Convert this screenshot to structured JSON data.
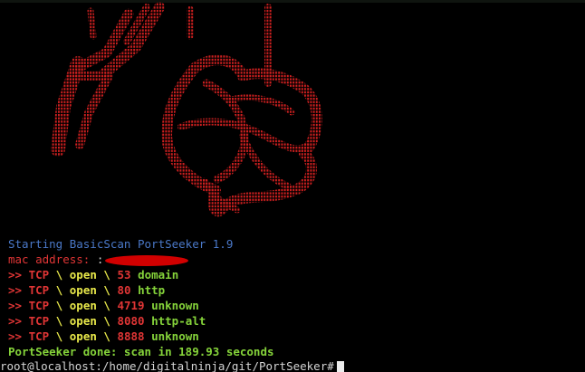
{
  "terminal": {
    "banner": "Starting BasicScan PortSeeker 1.9",
    "mac_label": "mac address:",
    "mac_value": ":",
    "ports": [
      {
        "prefix": ">>",
        "proto": "TCP",
        "sep1": "\\",
        "state": "open",
        "sep2": "\\",
        "port": "53",
        "service": "domain"
      },
      {
        "prefix": ">>",
        "proto": "TCP",
        "sep1": "\\",
        "state": "open",
        "sep2": "\\",
        "port": "80",
        "service": "http"
      },
      {
        "prefix": ">>",
        "proto": "TCP",
        "sep1": "\\",
        "state": "open",
        "sep2": "\\",
        "port": "4719",
        "service": "unknown"
      },
      {
        "prefix": ">>",
        "proto": "TCP",
        "sep1": "\\",
        "state": "open",
        "sep2": "\\",
        "port": "8080",
        "service": "http-alt"
      },
      {
        "prefix": ">>",
        "proto": "TCP",
        "sep1": "\\",
        "state": "open",
        "sep2": "\\",
        "port": "8888",
        "service": "unknown"
      }
    ],
    "done_message": "PortSeeker done: scan in 189.93 seconds",
    "prompt": "root@localhost:/home/digitalninja/git/PortSeeker#"
  },
  "colors": {
    "background": "#000000",
    "banner": "#4a78c8",
    "alert": "#e03535",
    "highlight": "#e8e84a",
    "success": "#85d33a",
    "prompt": "#d4d4d4",
    "ascii_art": "#cc1f1f"
  },
  "icons": {
    "ascii_art": "red-dotted-ascii-logo",
    "redaction": "red-redaction-mark"
  }
}
